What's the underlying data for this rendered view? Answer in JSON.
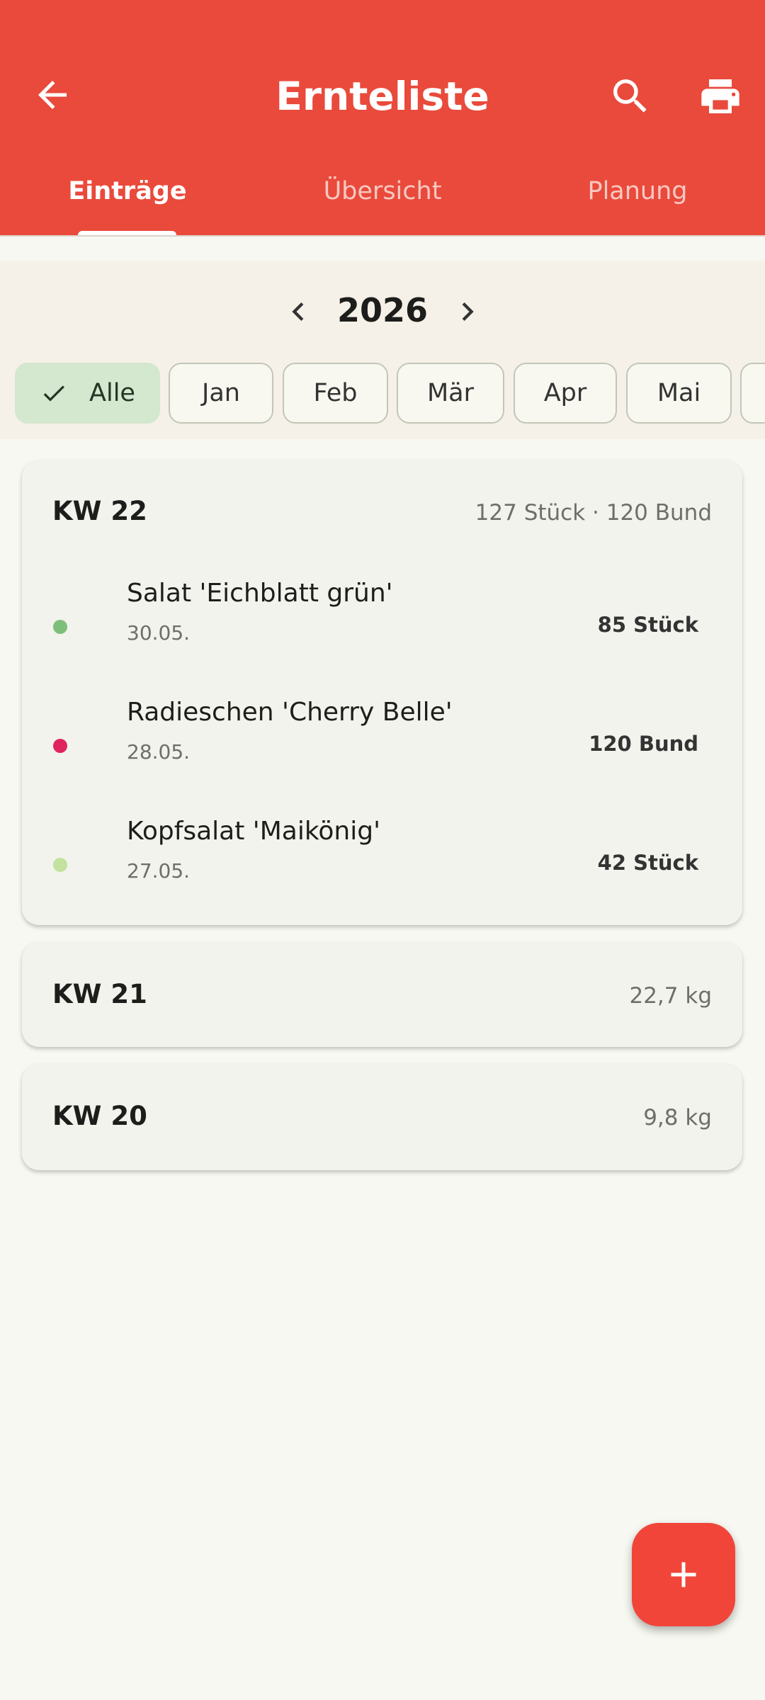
{
  "app": {
    "title": "Ernteliste",
    "accent_color": "#e94a3b"
  },
  "icons": {
    "back": "arrow-left-icon",
    "search": "search-icon",
    "print": "print-icon",
    "add": "plus-icon"
  },
  "tabs": [
    {
      "label": "Einträge",
      "active": true
    },
    {
      "label": "Übersicht",
      "active": false
    },
    {
      "label": "Planung",
      "active": false
    }
  ],
  "year_filter": {
    "year": "2026"
  },
  "month_chips": [
    {
      "label": "Alle",
      "selected": true
    },
    {
      "label": "Jan",
      "selected": false
    },
    {
      "label": "Feb",
      "selected": false
    },
    {
      "label": "Mär",
      "selected": false
    },
    {
      "label": "Apr",
      "selected": false
    },
    {
      "label": "Mai",
      "selected": false
    }
  ],
  "weeks": [
    {
      "title": "KW 22",
      "summary": "127 Stück · 120 Bund",
      "expanded": true,
      "entries": [
        {
          "name": "Salat 'Eichblatt grün'",
          "date": "30.05.",
          "quantity": "85 Stück",
          "color": "#7dbf7a"
        },
        {
          "name": "Radieschen 'Cherry Belle'",
          "date": "28.05.",
          "quantity": "120 Bund",
          "color": "#e0245e"
        },
        {
          "name": "Kopfsalat 'Maikönig'",
          "date": "27.05.",
          "quantity": "42 Stück",
          "color": "#c3e19f"
        }
      ]
    },
    {
      "title": "KW 21",
      "summary": "22,7 kg",
      "expanded": false
    },
    {
      "title": "KW 20",
      "summary": "9,8 kg",
      "expanded": false
    }
  ]
}
